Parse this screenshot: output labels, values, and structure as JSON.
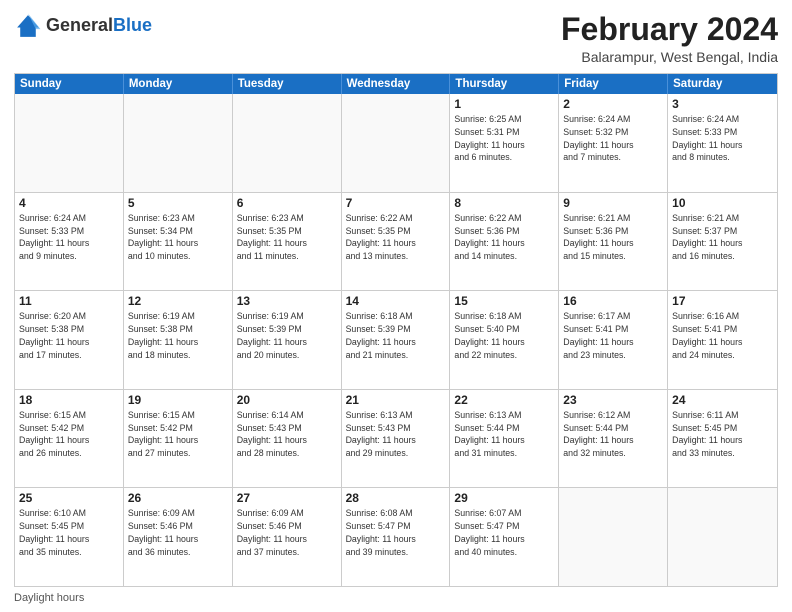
{
  "header": {
    "logo_general": "General",
    "logo_blue": "Blue",
    "main_title": "February 2024",
    "subtitle": "Balarampur, West Bengal, India"
  },
  "calendar": {
    "days_of_week": [
      "Sunday",
      "Monday",
      "Tuesday",
      "Wednesday",
      "Thursday",
      "Friday",
      "Saturday"
    ],
    "weeks": [
      [
        {
          "day": "",
          "info": ""
        },
        {
          "day": "",
          "info": ""
        },
        {
          "day": "",
          "info": ""
        },
        {
          "day": "",
          "info": ""
        },
        {
          "day": "1",
          "info": "Sunrise: 6:25 AM\nSunset: 5:31 PM\nDaylight: 11 hours\nand 6 minutes."
        },
        {
          "day": "2",
          "info": "Sunrise: 6:24 AM\nSunset: 5:32 PM\nDaylight: 11 hours\nand 7 minutes."
        },
        {
          "day": "3",
          "info": "Sunrise: 6:24 AM\nSunset: 5:33 PM\nDaylight: 11 hours\nand 8 minutes."
        }
      ],
      [
        {
          "day": "4",
          "info": "Sunrise: 6:24 AM\nSunset: 5:33 PM\nDaylight: 11 hours\nand 9 minutes."
        },
        {
          "day": "5",
          "info": "Sunrise: 6:23 AM\nSunset: 5:34 PM\nDaylight: 11 hours\nand 10 minutes."
        },
        {
          "day": "6",
          "info": "Sunrise: 6:23 AM\nSunset: 5:35 PM\nDaylight: 11 hours\nand 11 minutes."
        },
        {
          "day": "7",
          "info": "Sunrise: 6:22 AM\nSunset: 5:35 PM\nDaylight: 11 hours\nand 13 minutes."
        },
        {
          "day": "8",
          "info": "Sunrise: 6:22 AM\nSunset: 5:36 PM\nDaylight: 11 hours\nand 14 minutes."
        },
        {
          "day": "9",
          "info": "Sunrise: 6:21 AM\nSunset: 5:36 PM\nDaylight: 11 hours\nand 15 minutes."
        },
        {
          "day": "10",
          "info": "Sunrise: 6:21 AM\nSunset: 5:37 PM\nDaylight: 11 hours\nand 16 minutes."
        }
      ],
      [
        {
          "day": "11",
          "info": "Sunrise: 6:20 AM\nSunset: 5:38 PM\nDaylight: 11 hours\nand 17 minutes."
        },
        {
          "day": "12",
          "info": "Sunrise: 6:19 AM\nSunset: 5:38 PM\nDaylight: 11 hours\nand 18 minutes."
        },
        {
          "day": "13",
          "info": "Sunrise: 6:19 AM\nSunset: 5:39 PM\nDaylight: 11 hours\nand 20 minutes."
        },
        {
          "day": "14",
          "info": "Sunrise: 6:18 AM\nSunset: 5:39 PM\nDaylight: 11 hours\nand 21 minutes."
        },
        {
          "day": "15",
          "info": "Sunrise: 6:18 AM\nSunset: 5:40 PM\nDaylight: 11 hours\nand 22 minutes."
        },
        {
          "day": "16",
          "info": "Sunrise: 6:17 AM\nSunset: 5:41 PM\nDaylight: 11 hours\nand 23 minutes."
        },
        {
          "day": "17",
          "info": "Sunrise: 6:16 AM\nSunset: 5:41 PM\nDaylight: 11 hours\nand 24 minutes."
        }
      ],
      [
        {
          "day": "18",
          "info": "Sunrise: 6:15 AM\nSunset: 5:42 PM\nDaylight: 11 hours\nand 26 minutes."
        },
        {
          "day": "19",
          "info": "Sunrise: 6:15 AM\nSunset: 5:42 PM\nDaylight: 11 hours\nand 27 minutes."
        },
        {
          "day": "20",
          "info": "Sunrise: 6:14 AM\nSunset: 5:43 PM\nDaylight: 11 hours\nand 28 minutes."
        },
        {
          "day": "21",
          "info": "Sunrise: 6:13 AM\nSunset: 5:43 PM\nDaylight: 11 hours\nand 29 minutes."
        },
        {
          "day": "22",
          "info": "Sunrise: 6:13 AM\nSunset: 5:44 PM\nDaylight: 11 hours\nand 31 minutes."
        },
        {
          "day": "23",
          "info": "Sunrise: 6:12 AM\nSunset: 5:44 PM\nDaylight: 11 hours\nand 32 minutes."
        },
        {
          "day": "24",
          "info": "Sunrise: 6:11 AM\nSunset: 5:45 PM\nDaylight: 11 hours\nand 33 minutes."
        }
      ],
      [
        {
          "day": "25",
          "info": "Sunrise: 6:10 AM\nSunset: 5:45 PM\nDaylight: 11 hours\nand 35 minutes."
        },
        {
          "day": "26",
          "info": "Sunrise: 6:09 AM\nSunset: 5:46 PM\nDaylight: 11 hours\nand 36 minutes."
        },
        {
          "day": "27",
          "info": "Sunrise: 6:09 AM\nSunset: 5:46 PM\nDaylight: 11 hours\nand 37 minutes."
        },
        {
          "day": "28",
          "info": "Sunrise: 6:08 AM\nSunset: 5:47 PM\nDaylight: 11 hours\nand 39 minutes."
        },
        {
          "day": "29",
          "info": "Sunrise: 6:07 AM\nSunset: 5:47 PM\nDaylight: 11 hours\nand 40 minutes."
        },
        {
          "day": "",
          "info": ""
        },
        {
          "day": "",
          "info": ""
        }
      ]
    ]
  },
  "footer": {
    "text": "Daylight hours"
  }
}
